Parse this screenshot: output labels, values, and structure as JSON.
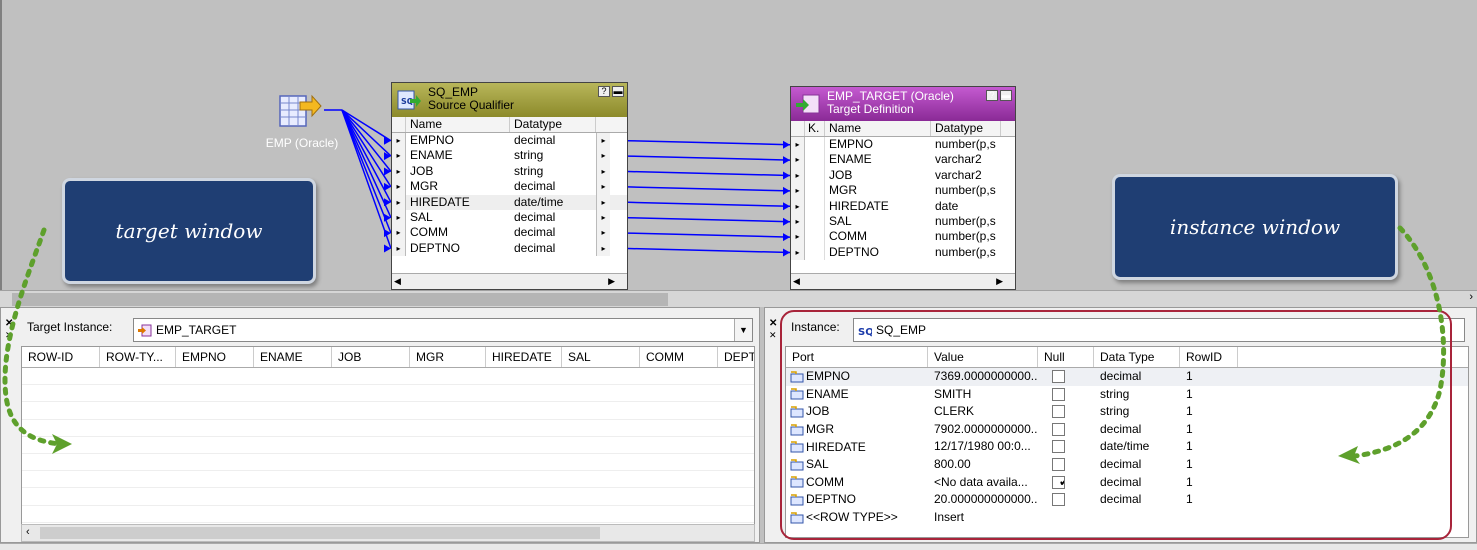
{
  "canvas": {
    "source": {
      "label": "EMP (Oracle)"
    },
    "qualifier": {
      "name": "SQ_EMP",
      "subtitle": "Source Qualifier",
      "col_name": "Name",
      "col_type": "Datatype",
      "buttons": [
        "?",
        "▬"
      ],
      "ports": [
        {
          "name": "EMPNO",
          "type": "decimal"
        },
        {
          "name": "ENAME",
          "type": "string"
        },
        {
          "name": "JOB",
          "type": "string"
        },
        {
          "name": "MGR",
          "type": "decimal"
        },
        {
          "name": "HIREDATE",
          "type": "date/time"
        },
        {
          "name": "SAL",
          "type": "decimal"
        },
        {
          "name": "COMM",
          "type": "decimal"
        },
        {
          "name": "DEPTNO",
          "type": "decimal"
        }
      ]
    },
    "target": {
      "name": "EMP_TARGET (Oracle)",
      "subtitle": "Target Definition",
      "col_key": "K.",
      "col_name": "Name",
      "col_type": "Datatype",
      "buttons": [
        "?",
        "▬"
      ],
      "ports": [
        {
          "name": "EMPNO",
          "type": "number(p,s"
        },
        {
          "name": "ENAME",
          "type": "varchar2"
        },
        {
          "name": "JOB",
          "type": "varchar2"
        },
        {
          "name": "MGR",
          "type": "number(p,s"
        },
        {
          "name": "HIREDATE",
          "type": "date"
        },
        {
          "name": "SAL",
          "type": "number(p,s"
        },
        {
          "name": "COMM",
          "type": "number(p,s"
        },
        {
          "name": "DEPTNO",
          "type": "number(p,s"
        }
      ]
    },
    "callouts": {
      "left": "target window",
      "right": "instance window"
    },
    "link_color": "#0000ff"
  },
  "target_panel": {
    "label": "Target Instance:",
    "selected": "EMP_TARGET",
    "columns": [
      "ROW-ID",
      "ROW-TY...",
      "EMPNO",
      "ENAME",
      "JOB",
      "MGR",
      "HIREDATE",
      "SAL",
      "COMM",
      "DEPT"
    ]
  },
  "instance_panel": {
    "label": "Instance:",
    "selected": "SQ_EMP",
    "columns": [
      "Port",
      "Value",
      "Null",
      "Data Type",
      "RowID"
    ],
    "rows": [
      {
        "port": "EMPNO",
        "value": "7369.0000000000...",
        "null": false,
        "type": "decimal",
        "rowid": "1"
      },
      {
        "port": "ENAME",
        "value": "SMITH",
        "null": false,
        "type": "string",
        "rowid": "1"
      },
      {
        "port": "JOB",
        "value": "CLERK",
        "null": false,
        "type": "string",
        "rowid": "1"
      },
      {
        "port": "MGR",
        "value": "7902.0000000000...",
        "null": false,
        "type": "decimal",
        "rowid": "1"
      },
      {
        "port": "HIREDATE",
        "value": "12/17/1980 00:0...",
        "null": false,
        "type": "date/time",
        "rowid": "1"
      },
      {
        "port": "SAL",
        "value": "800.00",
        "null": false,
        "type": "decimal",
        "rowid": "1"
      },
      {
        "port": "COMM",
        "value": "<No data availa...",
        "null": true,
        "type": "decimal",
        "rowid": "1"
      },
      {
        "port": "DEPTNO",
        "value": "20.000000000000...",
        "null": false,
        "type": "decimal",
        "rowid": "1"
      },
      {
        "port": "<<ROW TYPE>>",
        "value": "Insert",
        "null": null,
        "type": "",
        "rowid": ""
      }
    ]
  },
  "colors": {
    "qualifier_title": "#9a982e",
    "target_title": "#a040ac",
    "callout": "#1f3e73",
    "dotted_arrow": "#5ea02c",
    "annotation_border": "#a8243a"
  }
}
